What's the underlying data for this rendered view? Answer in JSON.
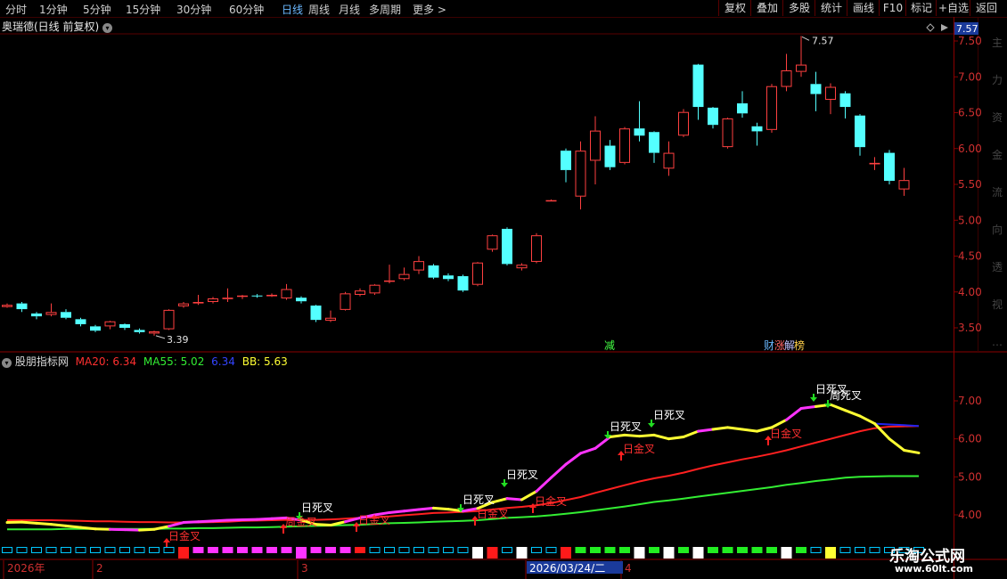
{
  "toolbar": {
    "tabs": [
      "分时",
      "1分钟",
      "5分钟",
      "15分钟",
      "30分钟",
      "60分钟",
      "日线",
      "周线",
      "月线",
      "多周期",
      "更多"
    ],
    "active_tab": "日线",
    "more_chevron": ">",
    "right_buttons": [
      "复权",
      "叠加",
      "多股",
      "统计",
      "画线",
      "F10",
      "标记",
      "+自选",
      "返回"
    ]
  },
  "main_panel": {
    "stock_title": "奥瑞德(日线 前复权)",
    "high_label": "7.57",
    "low_label": "3.39",
    "current_price_box": "7.57",
    "y_ticks": [
      "7.50",
      "7.00",
      "6.50",
      "6.00",
      "5.50",
      "5.00",
      "4.50",
      "4.00",
      "3.50"
    ],
    "event_tags": [
      {
        "text": "减",
        "color": "#44ff44"
      },
      {
        "text": "财",
        "color": "#6ab8ff"
      },
      {
        "text": "涨",
        "color": "#ff6666"
      },
      {
        "text": "解",
        "color": "#c0c0ff"
      },
      {
        "text": "榜",
        "color": "#ffd04a"
      }
    ],
    "right_side_chars": [
      "主",
      "力",
      "资",
      "金",
      "流",
      "向",
      "透",
      "视",
      "…"
    ]
  },
  "indicator_panel": {
    "name": "股朋指标网",
    "ma20_label": "MA20: 6.34",
    "ma55_label": "MA55: 5.02",
    "blue_label": "6.34",
    "bb_label": "BB: 5.63",
    "y_ticks": [
      "7.00",
      "6.00",
      "5.00",
      "4.00"
    ],
    "signals": [
      {
        "text": "日金叉",
        "color": "#ff3030",
        "x": 187,
        "y": 606
      },
      {
        "text": "周金叉",
        "color": "#ff3030",
        "x": 318,
        "y": 590
      },
      {
        "text": "日死叉",
        "color": "#ffffff",
        "x": 336,
        "y": 574
      },
      {
        "text": "日金叉",
        "color": "#ff3030",
        "x": 400,
        "y": 588
      },
      {
        "text": "日死叉",
        "color": "#ffffff",
        "x": 517,
        "y": 565
      },
      {
        "text": "日金叉",
        "color": "#ff3030",
        "x": 533,
        "y": 581
      },
      {
        "text": "日死叉",
        "color": "#ffffff",
        "x": 566,
        "y": 537
      },
      {
        "text": "日金叉",
        "color": "#ff3030",
        "x": 598,
        "y": 567
      },
      {
        "text": "日死叉",
        "color": "#ffffff",
        "x": 682,
        "y": 483
      },
      {
        "text": "日金叉",
        "color": "#ff3030",
        "x": 697,
        "y": 508
      },
      {
        "text": "日死叉",
        "color": "#ffffff",
        "x": 731,
        "y": 470
      },
      {
        "text": "日金叉",
        "color": "#ff3030",
        "x": 862,
        "y": 491
      },
      {
        "text": "日死叉",
        "color": "#ffffff",
        "x": 913,
        "y": 441
      },
      {
        "text": "周死叉",
        "color": "#ffffff",
        "x": 929,
        "y": 448
      }
    ]
  },
  "date_axis": {
    "labels": [
      "2026年",
      "2",
      "3",
      "2026/03/24/二",
      "4"
    ]
  },
  "watermark": {
    "site_name": "乐淘公式网",
    "url": "www.60lt.com"
  },
  "colors": {
    "up": "#ff4040",
    "down": "#54ffff",
    "ma_red": "#ff2020",
    "ma_green": "#33ee33",
    "line_yellow": "#ffff33",
    "line_magenta": "#ff33ff",
    "line_blue": "#2222ee",
    "axis": "#8b0000"
  },
  "chart_data": {
    "type": "candlestick",
    "ylim": [
      3.2,
      7.7
    ],
    "candles": [
      {
        "o": 3.79,
        "c": 3.82,
        "h": 3.84,
        "l": 3.78
      },
      {
        "o": 3.84,
        "c": 3.76,
        "h": 3.86,
        "l": 3.72
      },
      {
        "o": 3.7,
        "c": 3.66,
        "h": 3.72,
        "l": 3.62
      },
      {
        "o": 3.68,
        "c": 3.72,
        "h": 3.84,
        "l": 3.66
      },
      {
        "o": 3.72,
        "c": 3.64,
        "h": 3.76,
        "l": 3.62
      },
      {
        "o": 3.62,
        "c": 3.55,
        "h": 3.64,
        "l": 3.52
      },
      {
        "o": 3.52,
        "c": 3.46,
        "h": 3.54,
        "l": 3.44
      },
      {
        "o": 3.52,
        "c": 3.59,
        "h": 3.6,
        "l": 3.48
      },
      {
        "o": 3.55,
        "c": 3.5,
        "h": 3.56,
        "l": 3.47
      },
      {
        "o": 3.47,
        "c": 3.44,
        "h": 3.49,
        "l": 3.42
      },
      {
        "o": 3.42,
        "c": 3.45,
        "h": 3.46,
        "l": 3.39
      },
      {
        "o": 3.48,
        "c": 3.75,
        "h": 3.76,
        "l": 3.47
      },
      {
        "o": 3.8,
        "c": 3.84,
        "h": 3.86,
        "l": 3.78
      },
      {
        "o": 3.84,
        "c": 3.86,
        "h": 3.96,
        "l": 3.82
      },
      {
        "o": 3.86,
        "c": 3.91,
        "h": 3.93,
        "l": 3.84
      },
      {
        "o": 3.9,
        "c": 3.92,
        "h": 4.05,
        "l": 3.86
      },
      {
        "o": 3.94,
        "c": 3.95,
        "h": 3.96,
        "l": 3.9
      },
      {
        "o": 3.95,
        "c": 3.94,
        "h": 3.97,
        "l": 3.92
      },
      {
        "o": 3.94,
        "c": 3.96,
        "h": 3.98,
        "l": 3.93
      },
      {
        "o": 3.91,
        "c": 4.04,
        "h": 4.11,
        "l": 3.89
      },
      {
        "o": 3.92,
        "c": 3.87,
        "h": 3.94,
        "l": 3.84
      },
      {
        "o": 3.81,
        "c": 3.61,
        "h": 3.82,
        "l": 3.58
      },
      {
        "o": 3.6,
        "c": 3.64,
        "h": 3.74,
        "l": 3.58
      },
      {
        "o": 3.75,
        "c": 3.98,
        "h": 4.0,
        "l": 3.74
      },
      {
        "o": 3.96,
        "c": 4.02,
        "h": 4.05,
        "l": 3.94
      },
      {
        "o": 3.98,
        "c": 4.1,
        "h": 4.11,
        "l": 3.96
      },
      {
        "o": 4.16,
        "c": 4.16,
        "h": 4.38,
        "l": 4.12
      },
      {
        "o": 4.18,
        "c": 4.25,
        "h": 4.34,
        "l": 4.16
      },
      {
        "o": 4.3,
        "c": 4.43,
        "h": 4.5,
        "l": 4.25
      },
      {
        "o": 4.37,
        "c": 4.2,
        "h": 4.39,
        "l": 4.18
      },
      {
        "o": 4.23,
        "c": 4.18,
        "h": 4.26,
        "l": 4.15
      },
      {
        "o": 4.22,
        "c": 4.02,
        "h": 4.24,
        "l": 4.0
      },
      {
        "o": 4.1,
        "c": 4.41,
        "h": 4.42,
        "l": 4.08
      },
      {
        "o": 4.59,
        "c": 4.79,
        "h": 4.8,
        "l": 4.56
      },
      {
        "o": 4.88,
        "c": 4.39,
        "h": 4.9,
        "l": 4.37
      },
      {
        "o": 4.33,
        "c": 4.38,
        "h": 4.4,
        "l": 4.3
      },
      {
        "o": 4.42,
        "c": 4.79,
        "h": 4.82,
        "l": 4.4
      },
      {
        "o": 5.28,
        "c": 5.28,
        "h": 5.29,
        "l": 5.27
      },
      {
        "o": 5.97,
        "c": 5.7,
        "h": 6.0,
        "l": 5.53
      },
      {
        "o": 5.33,
        "c": 5.97,
        "h": 6.1,
        "l": 5.15
      },
      {
        "o": 5.83,
        "c": 6.25,
        "h": 6.45,
        "l": 5.5
      },
      {
        "o": 6.04,
        "c": 5.74,
        "h": 6.12,
        "l": 5.7
      },
      {
        "o": 5.8,
        "c": 6.28,
        "h": 6.3,
        "l": 5.78
      },
      {
        "o": 6.28,
        "c": 6.18,
        "h": 6.66,
        "l": 6.1
      },
      {
        "o": 6.23,
        "c": 5.94,
        "h": 6.24,
        "l": 5.8
      },
      {
        "o": 5.72,
        "c": 5.94,
        "h": 6.1,
        "l": 5.62
      },
      {
        "o": 6.18,
        "c": 6.51,
        "h": 6.55,
        "l": 6.16
      },
      {
        "o": 7.17,
        "c": 6.58,
        "h": 7.18,
        "l": 6.4
      },
      {
        "o": 6.57,
        "c": 6.33,
        "h": 6.58,
        "l": 6.28
      },
      {
        "o": 6.02,
        "c": 6.42,
        "h": 6.43,
        "l": 6.0
      },
      {
        "o": 6.63,
        "c": 6.49,
        "h": 6.8,
        "l": 6.43
      },
      {
        "o": 6.31,
        "c": 6.24,
        "h": 6.36,
        "l": 6.04
      },
      {
        "o": 6.26,
        "c": 6.87,
        "h": 6.9,
        "l": 6.22
      },
      {
        "o": 6.86,
        "c": 7.09,
        "h": 7.32,
        "l": 6.8
      },
      {
        "o": 7.07,
        "c": 7.17,
        "h": 7.57,
        "l": 7.0
      },
      {
        "o": 6.9,
        "c": 6.76,
        "h": 7.07,
        "l": 6.52
      },
      {
        "o": 6.68,
        "c": 6.86,
        "h": 6.91,
        "l": 6.48
      },
      {
        "o": 6.77,
        "c": 6.58,
        "h": 6.8,
        "l": 6.42
      },
      {
        "o": 6.46,
        "c": 6.02,
        "h": 6.48,
        "l": 5.9
      },
      {
        "o": 5.78,
        "c": 5.8,
        "h": 5.88,
        "l": 5.7
      },
      {
        "o": 5.94,
        "c": 5.55,
        "h": 5.98,
        "l": 5.5
      },
      {
        "o": 5.43,
        "c": 5.56,
        "h": 5.73,
        "l": 5.34
      }
    ],
    "ind_ylim": [
      3.5,
      7.9
    ],
    "ma20": [
      3.86,
      3.86,
      3.86,
      3.86,
      3.85,
      3.84,
      3.83,
      3.83,
      3.82,
      3.81,
      3.81,
      3.8,
      3.8,
      3.8,
      3.81,
      3.82,
      3.84,
      3.85,
      3.86,
      3.87,
      3.87,
      3.87,
      3.88,
      3.9,
      3.92,
      3.94,
      3.96,
      3.99,
      4.02,
      4.05,
      4.06,
      4.08,
      4.1,
      4.14,
      4.18,
      4.21,
      4.25,
      4.31,
      4.39,
      4.47,
      4.58,
      4.68,
      4.78,
      4.88,
      4.96,
      5.03,
      5.11,
      5.21,
      5.3,
      5.38,
      5.46,
      5.53,
      5.61,
      5.7,
      5.8,
      5.9,
      6.0,
      6.1,
      6.2,
      6.28,
      6.32,
      6.33,
      6.34
    ],
    "ma55": [
      3.62,
      3.62,
      3.62,
      3.62,
      3.63,
      3.63,
      3.63,
      3.63,
      3.63,
      3.63,
      3.63,
      3.64,
      3.64,
      3.65,
      3.65,
      3.66,
      3.67,
      3.67,
      3.68,
      3.69,
      3.7,
      3.71,
      3.72,
      3.73,
      3.74,
      3.76,
      3.78,
      3.79,
      3.8,
      3.82,
      3.83,
      3.84,
      3.86,
      3.89,
      3.92,
      3.94,
      3.96,
      3.99,
      4.03,
      4.07,
      4.12,
      4.17,
      4.22,
      4.28,
      4.34,
      4.38,
      4.43,
      4.48,
      4.53,
      4.58,
      4.63,
      4.68,
      4.73,
      4.79,
      4.84,
      4.89,
      4.93,
      4.98,
      5.0,
      5.01,
      5.02,
      5.02,
      5.02
    ],
    "bb": [
      3.8,
      3.81,
      3.78,
      3.75,
      3.71,
      3.67,
      3.63,
      3.62,
      3.61,
      3.6,
      3.62,
      3.7,
      3.8,
      3.82,
      3.84,
      3.86,
      3.87,
      3.88,
      3.9,
      3.92,
      3.86,
      3.75,
      3.73,
      3.82,
      3.92,
      4.0,
      4.06,
      4.1,
      4.14,
      4.18,
      4.15,
      4.1,
      4.17,
      4.33,
      4.43,
      4.4,
      4.62,
      4.98,
      5.33,
      5.62,
      5.75,
      6.05,
      6.1,
      6.07,
      6.1,
      6.0,
      6.05,
      6.2,
      6.25,
      6.3,
      6.25,
      6.2,
      6.3,
      6.5,
      6.8,
      6.85,
      6.9,
      6.75,
      6.6,
      6.4,
      6.0,
      5.7,
      5.63
    ],
    "bb_colors": [
      "y",
      "y",
      "y",
      "y",
      "y",
      "y",
      "y",
      "m",
      "m",
      "y",
      "y",
      "m",
      "m",
      "m",
      "m",
      "m",
      "m",
      "m",
      "m",
      "m",
      "y",
      "y",
      "y",
      "m",
      "m",
      "m",
      "m",
      "m",
      "m",
      "y",
      "y",
      "m",
      "y",
      "y",
      "m",
      "y",
      "m",
      "m",
      "m",
      "m",
      "m",
      "y",
      "y",
      "y",
      "y",
      "y",
      "y",
      "m",
      "y",
      "y",
      "y",
      "y",
      "y",
      "m",
      "m",
      "y",
      "y",
      "y",
      "y",
      "y",
      "y",
      "y",
      "y"
    ],
    "blue_tail_start": 59,
    "blue_tail": [
      6.4,
      6.38,
      6.36,
      6.34
    ],
    "squares": [
      "c",
      "c",
      "c",
      "c",
      "c",
      "c",
      "c",
      "c",
      "c",
      "c",
      "c",
      "c",
      "R",
      "m",
      "m",
      "m",
      "m",
      "m",
      "m",
      "m",
      "mb",
      "m",
      "m",
      "m",
      "r",
      "c",
      "c",
      "c",
      "c",
      "c",
      "c",
      "c",
      "wb",
      "rb",
      "c",
      "wb",
      "c",
      "c",
      "rb",
      "g",
      "g",
      "g",
      "g",
      "wb",
      "g",
      "wb",
      "g",
      "wb",
      "g",
      "g",
      "g",
      "g",
      "g",
      "wb",
      "g",
      "c",
      "yb",
      "c",
      "c",
      "c",
      "c",
      "c",
      "c"
    ]
  }
}
